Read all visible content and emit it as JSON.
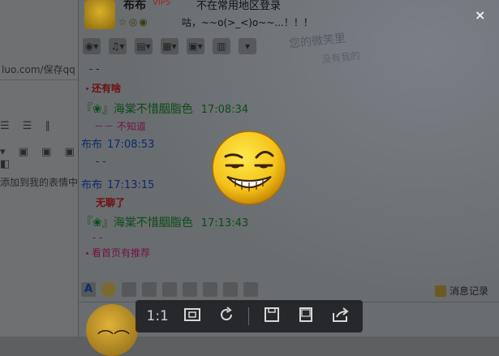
{
  "background_left": {
    "url_fragment": "luo.com/保存qq",
    "toolbar_row1": "☰ ☰ ∥",
    "toolbar_row2": "▾ ▣ ▣ ▣ ◧",
    "text_fragment": "添加到我的表情中"
  },
  "chat_header": {
    "nickname": "布布",
    "vip_badge": "VIP5",
    "region_notice": "不在常用地区登录",
    "signature_icons": "☆◎◉",
    "signature": "咕，~~o(>_<)o~~...！！！",
    "close_label": "×",
    "deco_text_1": "您的微笑里",
    "deco_text_2": "没有我的"
  },
  "toolbar": {
    "icons": [
      "camera-icon",
      "mic-icon",
      "folder-icon",
      "add-app-icon",
      "screen-share-icon",
      "remote-desktop-icon",
      "more-icon"
    ],
    "glyphs": [
      "◉▾",
      "♫▾",
      "▤▾",
      "▦▾",
      "▣▾",
      "▥",
      "▾"
    ]
  },
  "messages": [
    {
      "type": "dash",
      "text": "- -"
    },
    {
      "type": "bold-red",
      "text": "还有啥"
    },
    {
      "type": "sender-green",
      "name": "『❀』海棠不惜胭脂色",
      "time": "17:08:34"
    },
    {
      "type": "pink",
      "text": "－－ 不知道"
    },
    {
      "type": "sender-blue",
      "name": "布布",
      "time": "17:08:53"
    },
    {
      "type": "dash",
      "text": "- -"
    },
    {
      "type": "sender-blue",
      "name": "布布",
      "time": "17:13:15"
    },
    {
      "type": "bold-red",
      "text": "无聊了"
    },
    {
      "type": "sender-green",
      "name": "『❀』海棠不惜胭脂色",
      "time": "17:13:43"
    },
    {
      "type": "pink",
      "text": "- -"
    },
    {
      "type": "pink",
      "text": "看首页有推荐"
    }
  ],
  "input_toolbar": {
    "font_label": "A",
    "icons": [
      "font-icon",
      "emoji-icon",
      "shake-icon",
      "gif-icon",
      "voice-icon",
      "draw-icon",
      "image-icon",
      "music-icon",
      "screenshot-icon"
    ],
    "message_record_label": "消息记录"
  },
  "viewer": {
    "ratio_label": "1:1",
    "buttons": [
      "fit-window-icon",
      "rotate-icon",
      "save-icon",
      "open-icon",
      "share-icon"
    ]
  }
}
